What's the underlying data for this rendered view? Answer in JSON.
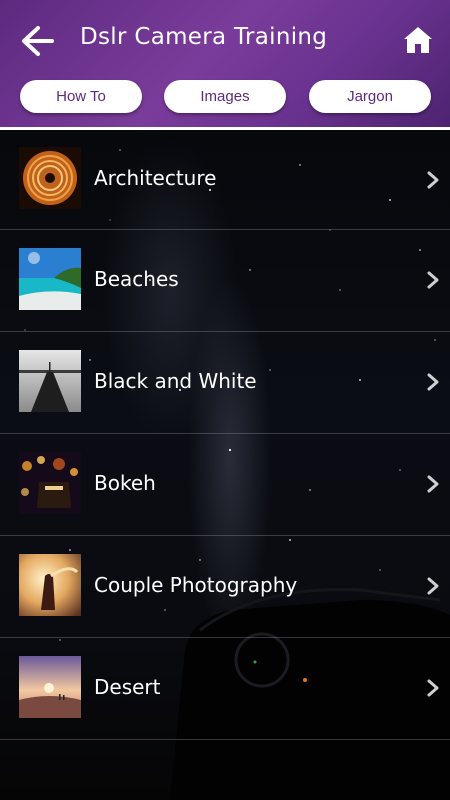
{
  "header": {
    "title": "Dslr Camera Training",
    "back_icon": "back-arrow-icon",
    "home_icon": "home-icon"
  },
  "tabs": [
    {
      "label": "How To"
    },
    {
      "label": "Images"
    },
    {
      "label": "Jargon"
    }
  ],
  "categories": [
    {
      "label": "Architecture",
      "thumb": "architecture-thumbnail"
    },
    {
      "label": "Beaches",
      "thumb": "beaches-thumbnail"
    },
    {
      "label": "Black and White",
      "thumb": "black-and-white-thumbnail"
    },
    {
      "label": "Bokeh",
      "thumb": "bokeh-thumbnail"
    },
    {
      "label": "Couple Photography",
      "thumb": "couple-photography-thumbnail"
    },
    {
      "label": "Desert",
      "thumb": "desert-thumbnail"
    }
  ],
  "colors": {
    "header_purple": "#6a3290",
    "tab_text": "#5d2a80",
    "list_text": "#ffffff"
  }
}
